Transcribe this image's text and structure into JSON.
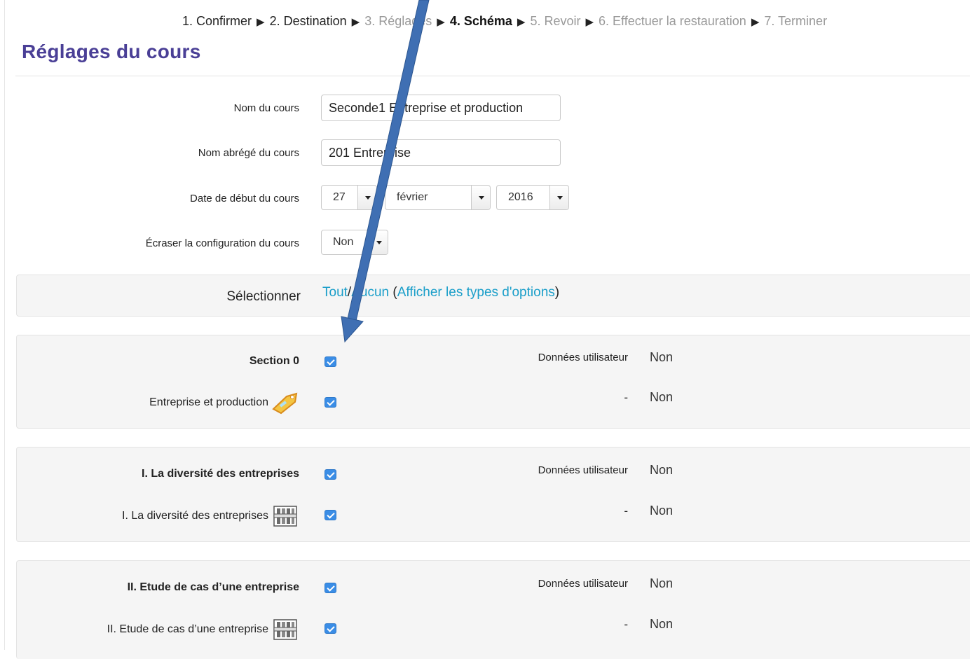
{
  "stepper": {
    "steps": [
      {
        "label": "1. Confirmer"
      },
      {
        "label": "2. Destination"
      },
      {
        "label": "3. Réglages"
      },
      {
        "label": "4. Schéma"
      },
      {
        "label": "5. Revoir"
      },
      {
        "label": "6. Effectuer la restauration"
      },
      {
        "label": "7. Terminer"
      }
    ],
    "separator": "▶"
  },
  "page_title": "Réglages du cours",
  "form": {
    "course_name_label": "Nom du cours",
    "course_name_value": "Seconde1 Entreprise et production",
    "short_name_label": "Nom abrégé du cours",
    "short_name_value": "201 Entreprise",
    "start_date_label": "Date de début du cours",
    "start_day": "27",
    "start_month": "février",
    "start_year": "2016",
    "overwrite_label": "Écraser la configuration du cours",
    "overwrite_value": "Non"
  },
  "selection": {
    "label": "Sélectionner",
    "all": "Tout",
    "slash": "/",
    "none": "Aucun",
    "open_paren": "(",
    "show_types": "Afficher les types d'options",
    "close_paren": ")"
  },
  "sections": [
    {
      "title": "Section 0",
      "user_data_label": "Données utilisateur",
      "user_data_value": "Non",
      "activity": {
        "label": "Entreprise et production",
        "icon": "label-tag-icon",
        "dash": "-",
        "value": "Non"
      }
    },
    {
      "title": "I. La diversité des entreprises",
      "user_data_label": "Données utilisateur",
      "user_data_value": "Non",
      "activity": {
        "label": "I. La diversité des entreprises",
        "icon": "book-icon",
        "dash": "-",
        "value": "Non"
      }
    },
    {
      "title": "II. Etude de cas d’une entreprise",
      "user_data_label": "Données utilisateur",
      "user_data_value": "Non",
      "activity": {
        "label": "II. Etude de cas d’une entreprise",
        "icon": "book-icon",
        "dash": "-",
        "value": "Non"
      }
    }
  ],
  "colors": {
    "title": "#4a3f96",
    "link": "#1a9ec9",
    "checkbox": "#3a8de6",
    "arrow": "#3f6fb3"
  }
}
